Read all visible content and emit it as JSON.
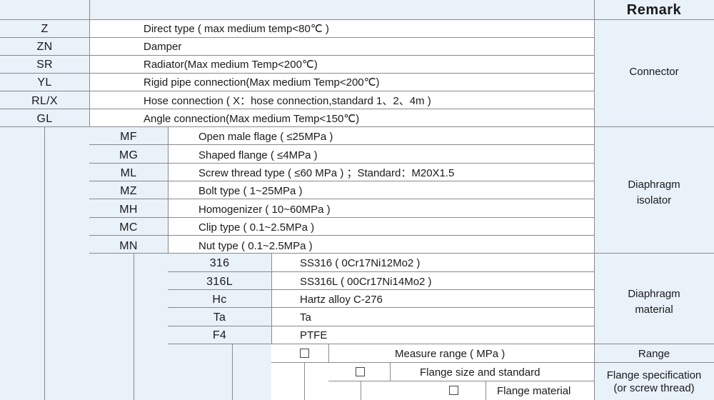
{
  "header": {
    "remark": "Remark"
  },
  "connector": {
    "rows": [
      {
        "code": "Z",
        "desc": "Direct type ( max medium temp<80℃ )"
      },
      {
        "code": "ZN",
        "desc": "Damper"
      },
      {
        "code": "SR",
        "desc": "Radiator(Max medium Temp<200℃)"
      },
      {
        "code": "YL",
        "desc": "Rigid pipe connection(Max medium Temp<200℃)"
      },
      {
        "code": "RL/X",
        "desc": "Hose connection ( X：hose connection,standard  1、2、4m )"
      },
      {
        "code": "GL",
        "desc": "Angle connection(Max medium Temp<150℃)"
      }
    ],
    "remark": "Connector"
  },
  "isolator": {
    "rows": [
      {
        "code": "MF",
        "desc": "Open male flage ( ≤25MPa )"
      },
      {
        "code": "MG",
        "desc": "Shaped flange ( ≤4MPa )"
      },
      {
        "code": "ML",
        "desc": "Screw thread type ( ≤60 MPa ) ；Standard：M20X1.5"
      },
      {
        "code": "MZ",
        "desc": "Bolt type ( 1~25MPa )"
      },
      {
        "code": "MH",
        "desc": "Homogenizer ( 10~60MPa )"
      },
      {
        "code": "MC",
        "desc": "Clip type ( 0.1~2.5MPa )"
      },
      {
        "code": "MN",
        "desc": "Nut type ( 0.1~2.5MPa )"
      }
    ],
    "remark_line1": "Diaphragm",
    "remark_line2": "isolator"
  },
  "material": {
    "rows": [
      {
        "code": "316",
        "desc": "SS316 ( 0Cr17Ni12Mo2 )"
      },
      {
        "code": "316L",
        "desc": "SS316L ( 00Cr17Ni14Mo2 )"
      },
      {
        "code": "Hc",
        "desc": "Hartz alloy C-276"
      },
      {
        "code": "Ta",
        "desc": "Ta"
      },
      {
        "code": "F4",
        "desc": "PTFE"
      }
    ],
    "remark_line1": "Diaphragm",
    "remark_line2": "material"
  },
  "range": {
    "desc": "Measure range ( MPa )",
    "remark": "Range"
  },
  "flange_size": {
    "desc": "Flange size and standard",
    "remark_line1": "Flange specification",
    "remark_line2": "(or screw thread)"
  },
  "flange_material": {
    "desc": "Flange material"
  }
}
